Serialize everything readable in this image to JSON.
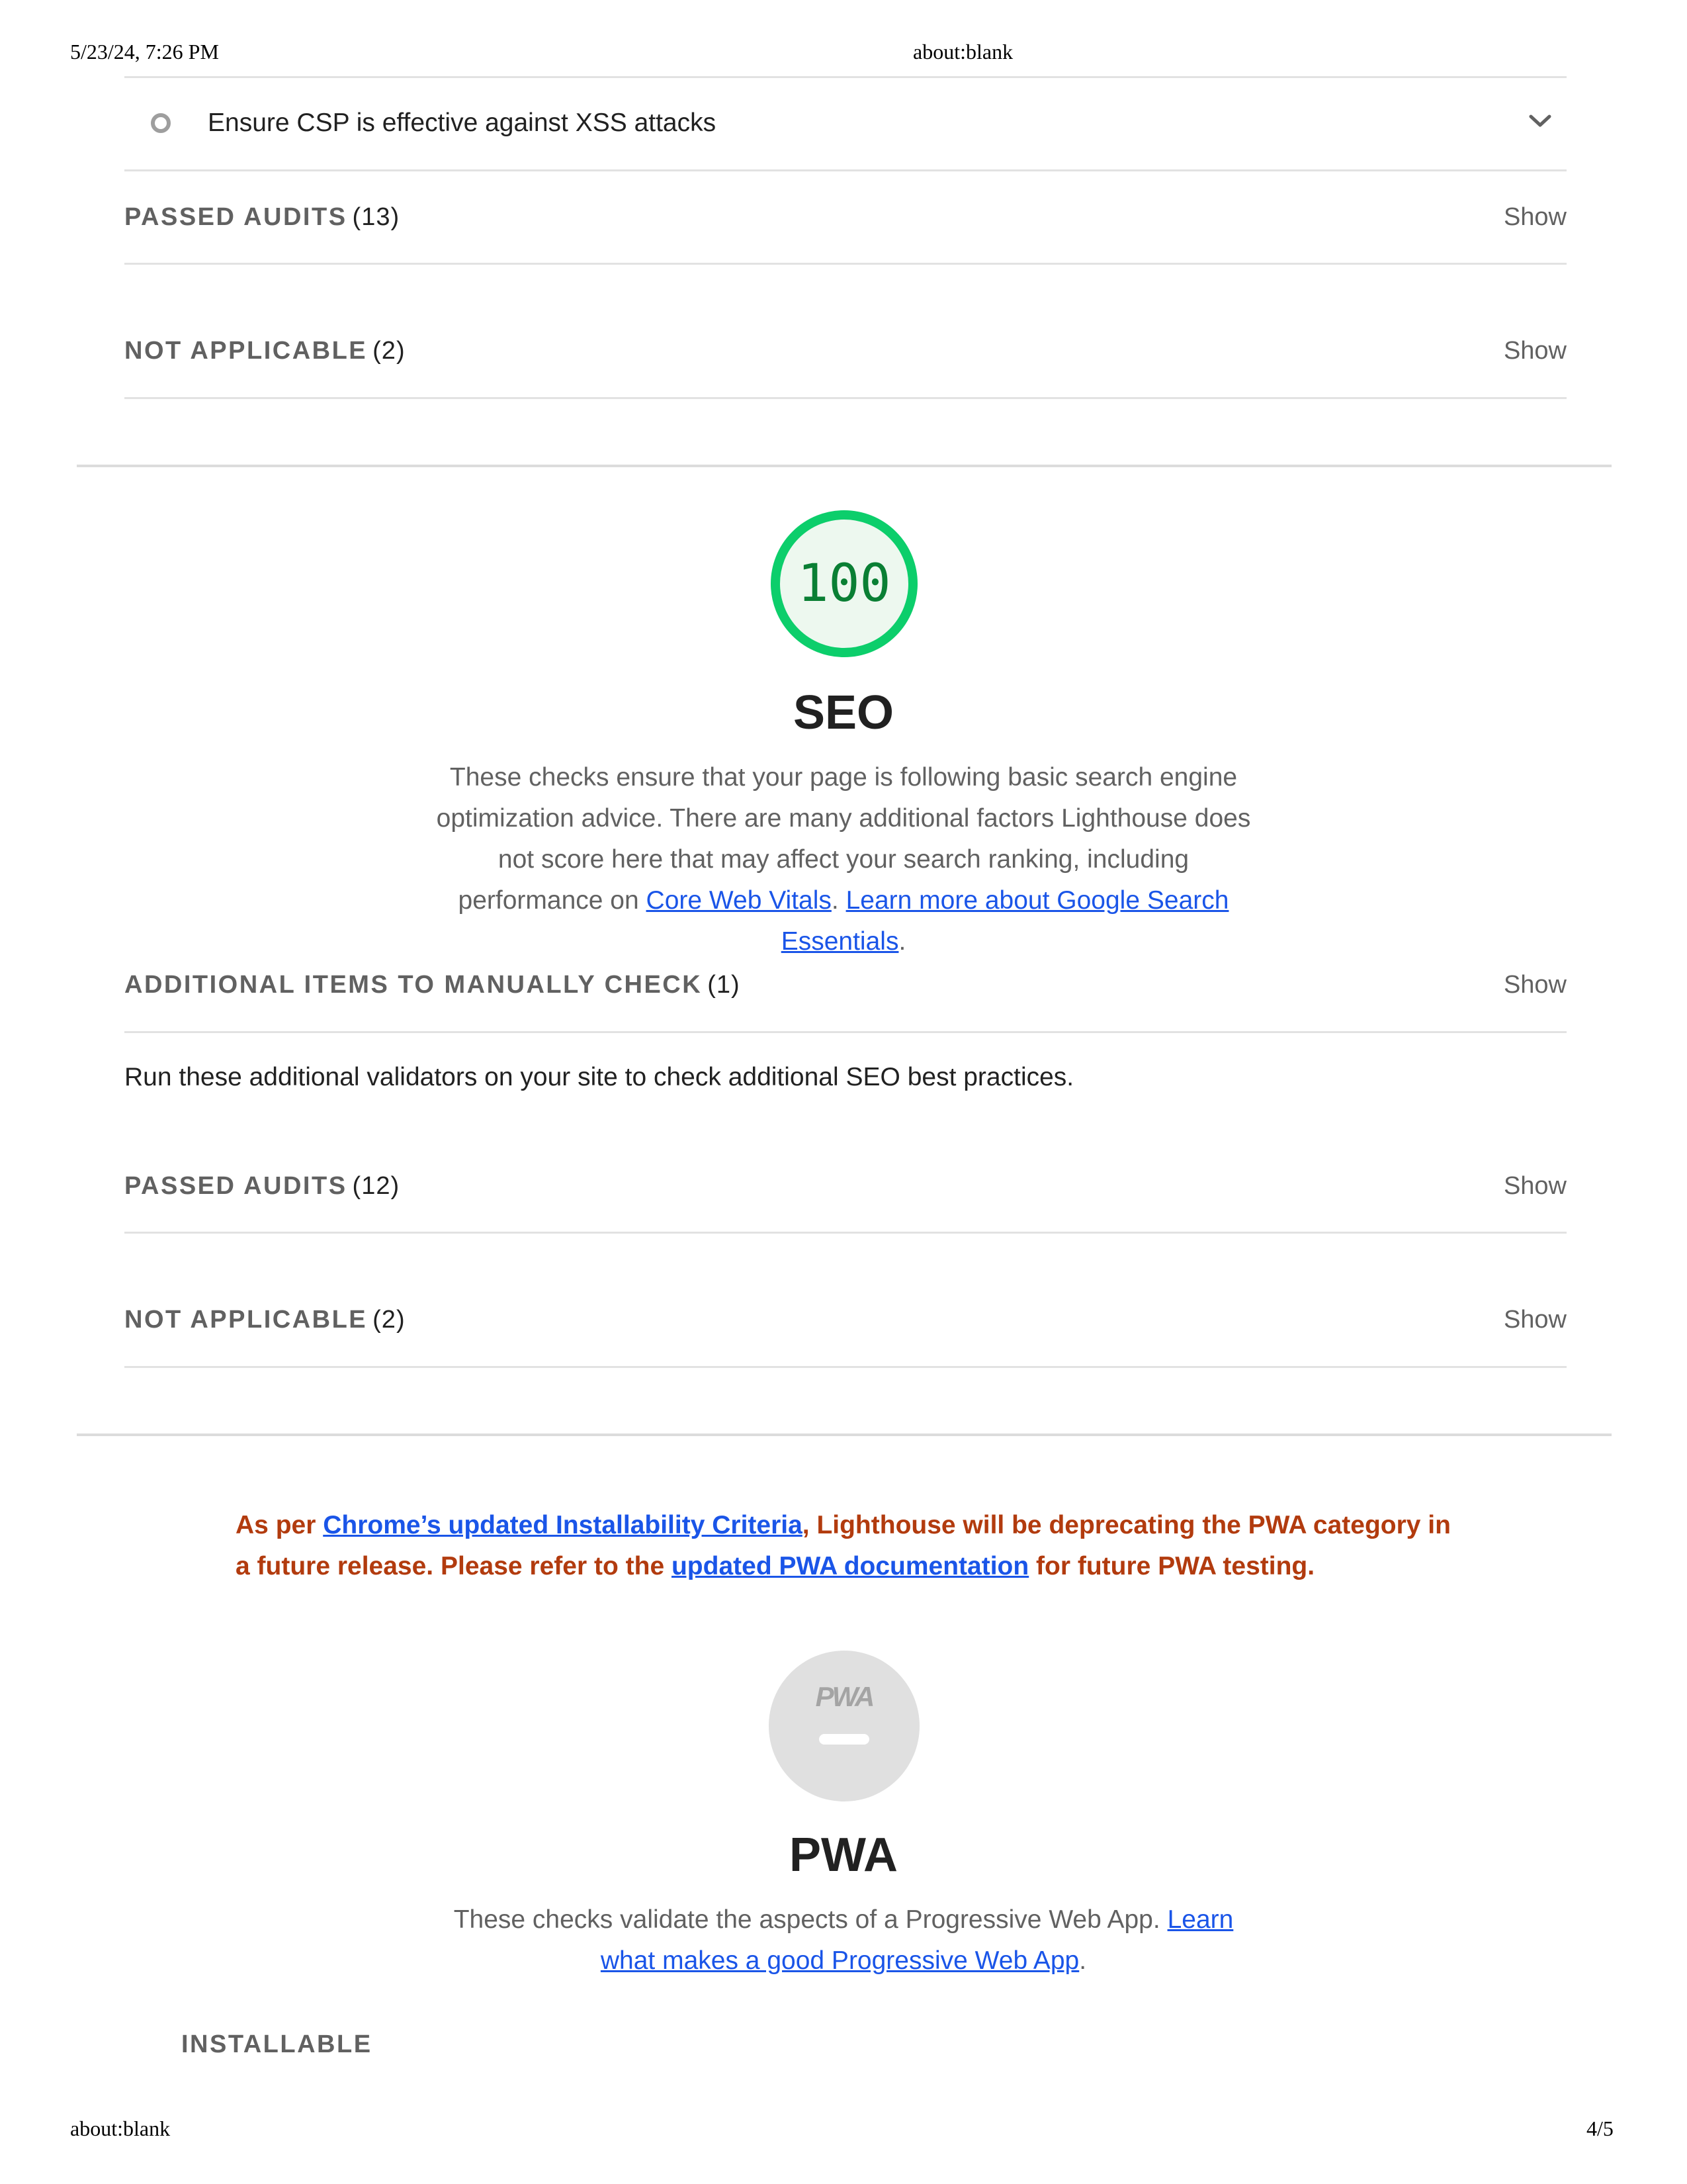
{
  "print_header": {
    "datetime": "5/23/24, 7:26 PM",
    "title": "about:blank"
  },
  "print_footer": {
    "url": "about:blank",
    "page": "4/5"
  },
  "best_practices_tail": {
    "manual_audit": {
      "label": "Ensure CSP is effective against XSS attacks",
      "status_icon": "informative-circle-icon"
    },
    "passed": {
      "title": "PASSED AUDITS",
      "count": "(13)",
      "show_label": "Show"
    },
    "not_applicable": {
      "title": "NOT APPLICABLE",
      "count": "(2)",
      "show_label": "Show"
    }
  },
  "seo": {
    "score": "100",
    "score_fraction": 1.0,
    "gauge_color": "#0cce6b",
    "score_text_color": "#0a7f34",
    "title": "SEO",
    "description_text": "These checks ensure that your page is following basic search engine optimization advice. There are many additional factors Lighthouse does not score here that may affect your search ranking, including performance on",
    "description_link1": "Core Web Vitals",
    "description_sep": ".",
    "description_link2": "Learn more about Google Search Essentials",
    "description_end": ".",
    "manual": {
      "title": "ADDITIONAL ITEMS TO MANUALLY CHECK",
      "count": "(1)",
      "show_label": "Show"
    },
    "manual_description": "Run these additional validators on your site to check additional SEO best practices.",
    "passed": {
      "title": "PASSED AUDITS",
      "count": "(12)",
      "show_label": "Show"
    },
    "not_applicable": {
      "title": "NOT APPLICABLE",
      "count": "(2)",
      "show_label": "Show"
    }
  },
  "pwa_warning": {
    "part1": "As per",
    "link1": "Chrome’s updated Installability Criteria",
    "part2": ", Lighthouse will be deprecating the PWA category in a future release. Please refer to the",
    "link2": "updated PWA documentation",
    "part3": "for future PWA testing.",
    "color": "#b23b0e"
  },
  "pwa": {
    "badge_text": "PWA",
    "title": "PWA",
    "description_text": "These checks validate the aspects of a Progressive Web App.",
    "description_link": "Learn what makes a good Progressive Web App",
    "description_end": ".",
    "subgroup_title": "INSTALLABLE"
  },
  "colors": {
    "link": "#1a55e8",
    "muted": "#616161",
    "divider": "#e2e2e2"
  }
}
